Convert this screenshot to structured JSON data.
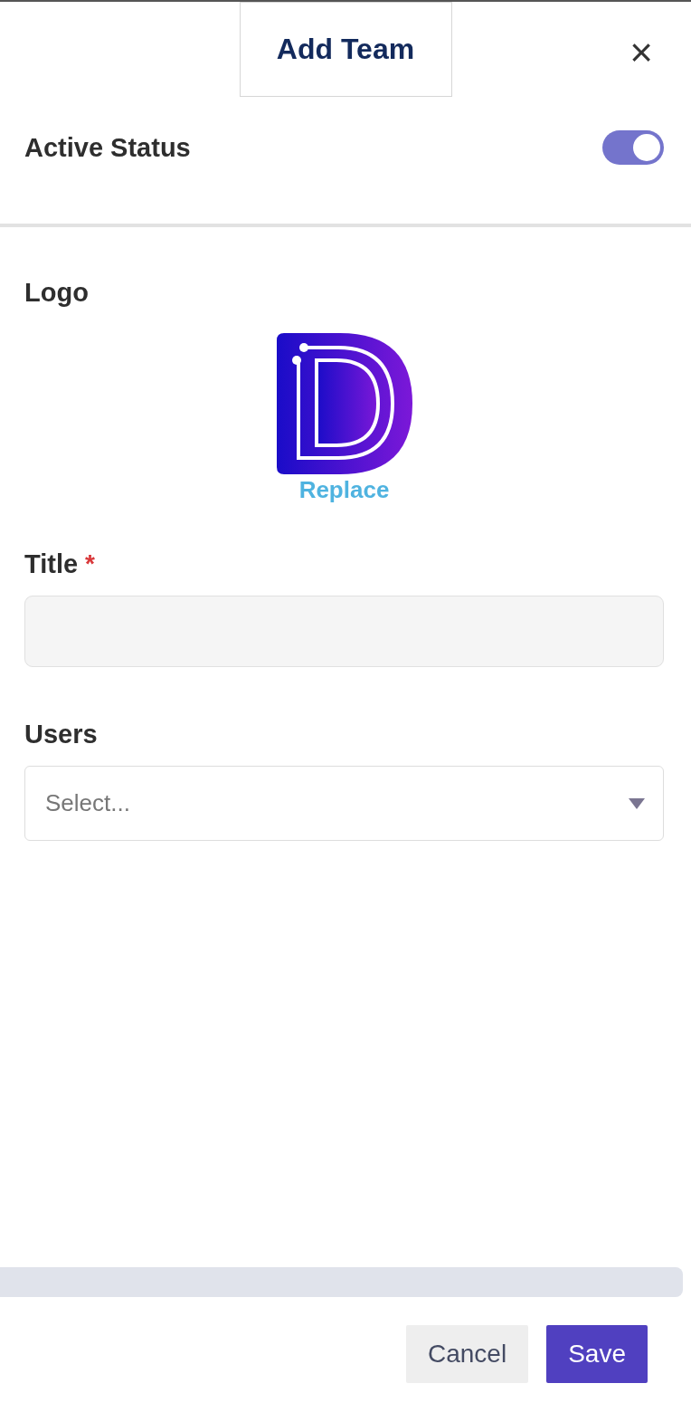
{
  "dialog": {
    "title": "Add Team",
    "close": "×"
  },
  "active_status": {
    "label": "Active Status",
    "on": true
  },
  "logo": {
    "label": "Logo",
    "action": "Replace"
  },
  "fields": [
    {
      "kind": "text",
      "label": "Title",
      "required_mark": "*"
    },
    {
      "kind": "select",
      "label": "Users",
      "placeholder": "Select..."
    }
  ],
  "buttons": [
    {
      "kind": "secondary",
      "label": "Cancel"
    },
    {
      "kind": "primary",
      "label": "Save"
    }
  ]
}
